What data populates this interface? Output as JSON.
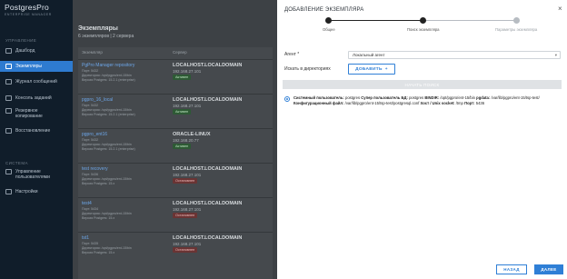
{
  "app": {
    "logo_title": "PostgresPro",
    "logo_subtitle": "ENTERPRISE MANAGER"
  },
  "sidebar": {
    "section_management": "УПРАВЛЕНИЕ",
    "section_system": "СИСТЕМА",
    "items": [
      {
        "label": "Дашборд",
        "icon": "dashboard-icon"
      },
      {
        "label": "Экземпляры",
        "icon": "instances-icon"
      },
      {
        "label": "Журнал сообщений",
        "icon": "log-icon"
      },
      {
        "label": "Консоль заданий",
        "icon": "console-icon"
      },
      {
        "label": "Резервное копирование",
        "icon": "backup-icon"
      },
      {
        "label": "Восстановление",
        "icon": "restore-icon"
      },
      {
        "label": "Управление пользователями",
        "icon": "users-icon"
      },
      {
        "label": "Настройки",
        "icon": "settings-icon"
      }
    ]
  },
  "main": {
    "title": "Экземпляры",
    "subtitle": "6 экземпляров | 2 сервера",
    "headers": [
      "Экземпляр",
      "Сервер"
    ],
    "rows": [
      {
        "name": "PgPro Manager repository",
        "port": "Порт: 5432",
        "dir": "Директория: /opt/pgpro/ent-15/bin",
        "version": "Версия Postgres: 15.2.1 (enterprise)",
        "host": "LOCALHOST.LOCALDOMAIN",
        "ip": "192.168.27.101",
        "status": "Активен",
        "status_kind": "ok"
      },
      {
        "name": "pgpro_16_local",
        "port": "Порт: 5432",
        "dir": "Директория: /opt/pgpro/ent-15/bin",
        "version": "Версия Postgres: 15.2.1 (enterprise)",
        "host": "LOCALHOST.LOCALDOMAIN",
        "ip": "192.168.27.101",
        "status": "Активен",
        "status_kind": "ok"
      },
      {
        "name": "pgpro_ent16",
        "port": "Порт: 5432",
        "dir": "Директория: /opt/pgpro/ent-15/bin",
        "version": "Версия Postgres: 15.2.1 (enterprise)",
        "host": "ORACLE-LINUX",
        "ip": "192.168.20.77",
        "status": "Активен",
        "status_kind": "ok"
      },
      {
        "name": "test recovery",
        "port": "Порт: 5436",
        "dir": "Директория: /opt/pgpro/ent-15/bin",
        "version": "Версия Postgres: 15.x",
        "host": "LOCALHOST.LOCALDOMAIN",
        "ip": "192.168.27.101",
        "status": "Остановлен",
        "status_kind": "stop"
      },
      {
        "name": "test4",
        "port": "Порт: 5434",
        "dir": "Директория: /opt/pgpro/ent-15/bin",
        "version": "Версия Postgres: 15.x",
        "host": "LOCALHOST.LOCALDOMAIN",
        "ip": "192.168.27.101",
        "status": "Остановлен",
        "status_kind": "stop"
      },
      {
        "name": "tst1",
        "port": "Порт: 5435",
        "dir": "Директория: /opt/pgpro/ent-15/bin",
        "version": "Версия Postgres: 15.x",
        "host": "LOCALHOST.LOCALDOMAIN",
        "ip": "192.168.27.101",
        "status": "Остановлен",
        "status_kind": "stop"
      }
    ]
  },
  "dialog": {
    "title": "ДОБАВЛЕНИЕ ЭКЗЕМПЛЯРА",
    "close": "×",
    "steps": [
      {
        "label": "Общее",
        "state": "done"
      },
      {
        "label": "Поиск экземпляра",
        "state": "current"
      },
      {
        "label": "Параметры экземпляра",
        "state": "todo"
      }
    ],
    "agent_label": "Агент *",
    "agent_value": "Локальный агент",
    "search_dirs_label": "Искать в директориях",
    "add_button": "ДОБАВИТЬ",
    "start_search_button": "НАЧАТЬ ПОИСК",
    "result": {
      "line1": [
        {
          "k": "Системный пользователь:",
          "v": "postgres"
        },
        {
          "k": "Супер пользователь БД:",
          "v": "postgres"
        },
        {
          "k": "BINDIR:",
          "v": "/opt/pgpro/ent-15/bin"
        },
        {
          "k": "pgdata:",
          "v": "/var/lib/pgpro/ent-15/tsp-test/"
        }
      ],
      "line2": [
        {
          "k": "Конфигурационный файл:",
          "v": "/var/lib/pgpro/ent-15/tsp-test/postgresql.conf"
        },
        {
          "k": "Хост / Unix socket:",
          "v": "/tmp"
        },
        {
          "k": "Порт:",
          "v": "5436"
        }
      ]
    },
    "back_button": "НАЗАД",
    "next_button": "ДАЛЕЕ"
  }
}
